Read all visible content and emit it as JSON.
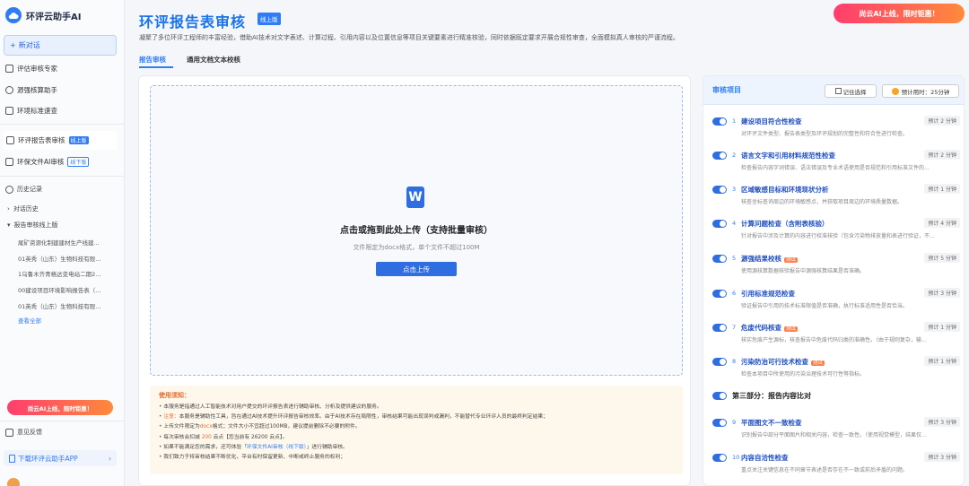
{
  "app": {
    "name": "环评云助手AI",
    "new_chat": "新对话"
  },
  "sidebar": {
    "tools": [
      {
        "label": "评估审核专家"
      },
      {
        "label": "源强核算助手"
      },
      {
        "label": "环境标准速查"
      }
    ],
    "review": [
      {
        "label": "环评报告表审核",
        "tag": "线上版"
      },
      {
        "label": "环保文件AI审核",
        "tag": "线下版"
      }
    ],
    "history_title": "历史记录",
    "history_groups": [
      "对话历史",
      "报告审核线上版"
    ],
    "history_items": [
      "尾矿资源化制建建材生产线建...",
      "01英秀（山东）生物科技有限...",
      "1乌鲁木齐青格达变电站二期2...",
      "00建设项目环境影响报告表（...",
      "01英秀（山东）生物科技有限..."
    ],
    "view_all": "查看全部",
    "promo": "尚云AI上线，限时钜惠！",
    "feedback": "意见反馈",
    "download": "下载环评云助手APP",
    "download_arrow": "›"
  },
  "header": {
    "title": "环评报告表审核",
    "tag": "线上版",
    "promo": "尚云AI上线，限时钜惠！"
  },
  "description": "凝聚了多位环评工程师的丰富经验，借助AI技术对文字表述、计算过程、引用内容以及位置信息等项目关键要素进行精准核验，同时依据既定要求开展合规性审查，全面模拟真人审核的严谨流程。",
  "tabs": [
    "报告审核",
    "通用文档文本校核"
  ],
  "upload": {
    "title": "点击或拖到此处上传（支持批量审核）",
    "subtitle": "文件限定为docx格式，单个文件不超过100M",
    "button": "点击上传"
  },
  "notice": {
    "title": "使用须知：",
    "lines": [
      {
        "pre": "",
        "hl": "",
        "text": "本服务是指通过人工智能技术对用户提交的环评报告表进行辅助审核、分析及提供建议的服务。"
      },
      {
        "pre": "",
        "hl": "注意：",
        "text": "本服务是辅助性工具，旨在通过AI技术提升环评报告审核效率。由于AI技术存在局限性，审核结果可能出现误判或漏判，不能替代专业环评人员的最终判定结果；"
      },
      {
        "pre": "上传文件限定为",
        "hl": "docx",
        "text": "格式；文件大小不宜超过100MB，建议提前删除不必要的附件。"
      },
      {
        "pre": "每次审核会扣减 ",
        "hl": "200",
        "text": " 云点【您当前有 26200 云点】。"
      },
      {
        "pre": "如果不能满足您的需求，还可体验「",
        "hl": "环保文件AI审核（线下版）",
        "text": "」进行辅助审核。"
      },
      {
        "pre": "",
        "hl": "",
        "text": "我们致力于将审核结果不断优化，平台有时保留更新、中断或终止服务的权利；"
      }
    ]
  },
  "review_panel": {
    "title": "审核项目",
    "remember": "记住选择",
    "eta": "预计用时：25分钟",
    "items": [
      {
        "num": "1",
        "name": "建设项目符合性检查",
        "badge": "",
        "est": "预计 2 分钟",
        "desc": "对环评文件类型、报告表类型及环评规划的完整性和符合性进行检查。"
      },
      {
        "num": "2",
        "name": "语言文字和引用材料规范性检查",
        "badge": "",
        "est": "预计 2 分钟",
        "desc": "检查报告内容字词错误、语法错误及专业术语使用是否规范和引用标准文件的..."
      },
      {
        "num": "3",
        "name": "区域敏感目标和环境现状分析",
        "badge": "",
        "est": "预计 1 分钟",
        "desc": "核查坐标查询周边的环境敏感点，并获取项目周边的环境质量数据。"
      },
      {
        "num": "4",
        "name": "计算问题检查（含附表核验）",
        "badge": "",
        "est": "预计 4 分钟",
        "desc": "针对报告中涉及计算的内容进行校准核验（包含污染物排放量和表进行验证，不..."
      },
      {
        "num": "5",
        "name": "源强结果校核",
        "badge": "测试",
        "est": "预计 5 分钟",
        "desc": "使用源核算数据核验报告中源强核算结果是否准确。"
      },
      {
        "num": "6",
        "name": "引用标准规范检查",
        "badge": "",
        "est": "预计 3 分钟",
        "desc": "验证报告中引用的技术标准限值是否准确，执行标准适用性是否恰当。"
      },
      {
        "num": "7",
        "name": "危废代码核查",
        "badge": "测试",
        "est": "预计 1 分钟",
        "desc": "核实危废产生源标，核查报告中危废代码归类的准确性。（由于规则复杂，输..."
      },
      {
        "num": "8",
        "name": "污染防治可行技术检查",
        "badge": "测试",
        "est": "预计 1 分钟",
        "desc": "检查本项目中所使用的污染治理技术可行性等指标。"
      }
    ],
    "section3": "第三部分：报告内容比对",
    "items2": [
      {
        "num": "9",
        "name": "平面图文不一致检查",
        "badge": "",
        "est": "预计 3 分钟",
        "desc": "识别报告中部分平面图片和相关内容，检查一致性。（使用视觉模型，结果仅..."
      },
      {
        "num": "10",
        "name": "内容自洽性检查",
        "badge": "",
        "est": "预计 3 分钟",
        "desc": "重点关注关键信息在不同章节表述是否存在不一致或前后矛盾的问题。"
      }
    ]
  },
  "colors": {
    "accent": "#2f7cf6",
    "brand_title": "#1a73e8",
    "warning": "#e66a2c",
    "notice_bg": "#fef8ec"
  }
}
